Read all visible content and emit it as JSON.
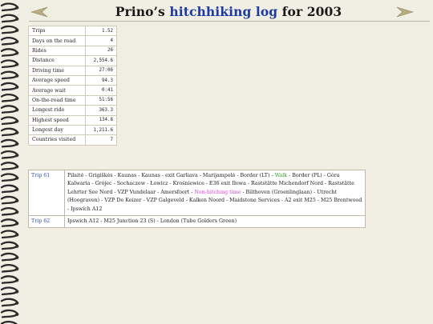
{
  "header": {
    "title_prefix": "Prino’s ",
    "title_link": "hitchhiking log",
    "title_suffix": " for 2003",
    "prev_icon": "left-arrow-icon",
    "next_icon": "right-arrow-icon"
  },
  "stats": [
    {
      "label": "Trips",
      "value": "1.52"
    },
    {
      "label": "Days on the road",
      "value": "4"
    },
    {
      "label": "Rides",
      "value": "26"
    },
    {
      "label": "Distance",
      "value": "2,554.6"
    },
    {
      "label": "Driving time",
      "value": "27:06"
    },
    {
      "label": "Average speed",
      "value": "94.3"
    },
    {
      "label": "Average wait",
      "value": "0:41"
    },
    {
      "label": "On-the-road time",
      "value": "51:56"
    },
    {
      "label": "Longest ride",
      "value": "363.3"
    },
    {
      "label": "Highest speed",
      "value": "134.8"
    },
    {
      "label": "Longest day",
      "value": "1,211.6"
    },
    {
      "label": "Countries visited",
      "value": "7"
    }
  ],
  "trips": [
    {
      "id": "Trip 61",
      "route_a": "Pilaitė - Grigiškės - Kaunas - Kaunas - exit Garliava - Marijampolė - Border (LT) - ",
      "walk": "Walk",
      "route_b": " - Border (PL) - Góra Kalwaria - Grójec - Sochaczew - Łowicz - Krośniewice - E36 exit Iłowa - Raststätte Michendorf Nord - Raststätte Lehrter See Nord - VZP Vundelaar - Amersfoort - ",
      "nonhitch": "Non-hitching time",
      "route_c": " - Bilthoven (Groenlinglaan) - Utrecht (Hoograven) - VZP De Keizer - VZP Galgeveld - Kalken Noord - Maidstone Services - A2 exit M25 - M25 Brentwood - Ipswich A12"
    },
    {
      "id": "Trip 62",
      "route": "Ipswich A12 - M25 Junction 23 (S) - London (Tube Golders Green)"
    }
  ],
  "colors": {
    "background": "#f1efe4",
    "link": "#2b51b8",
    "walk": "#2f9a2f",
    "non_hitching": "#d23fd2",
    "arrow": "#b7ad82"
  }
}
